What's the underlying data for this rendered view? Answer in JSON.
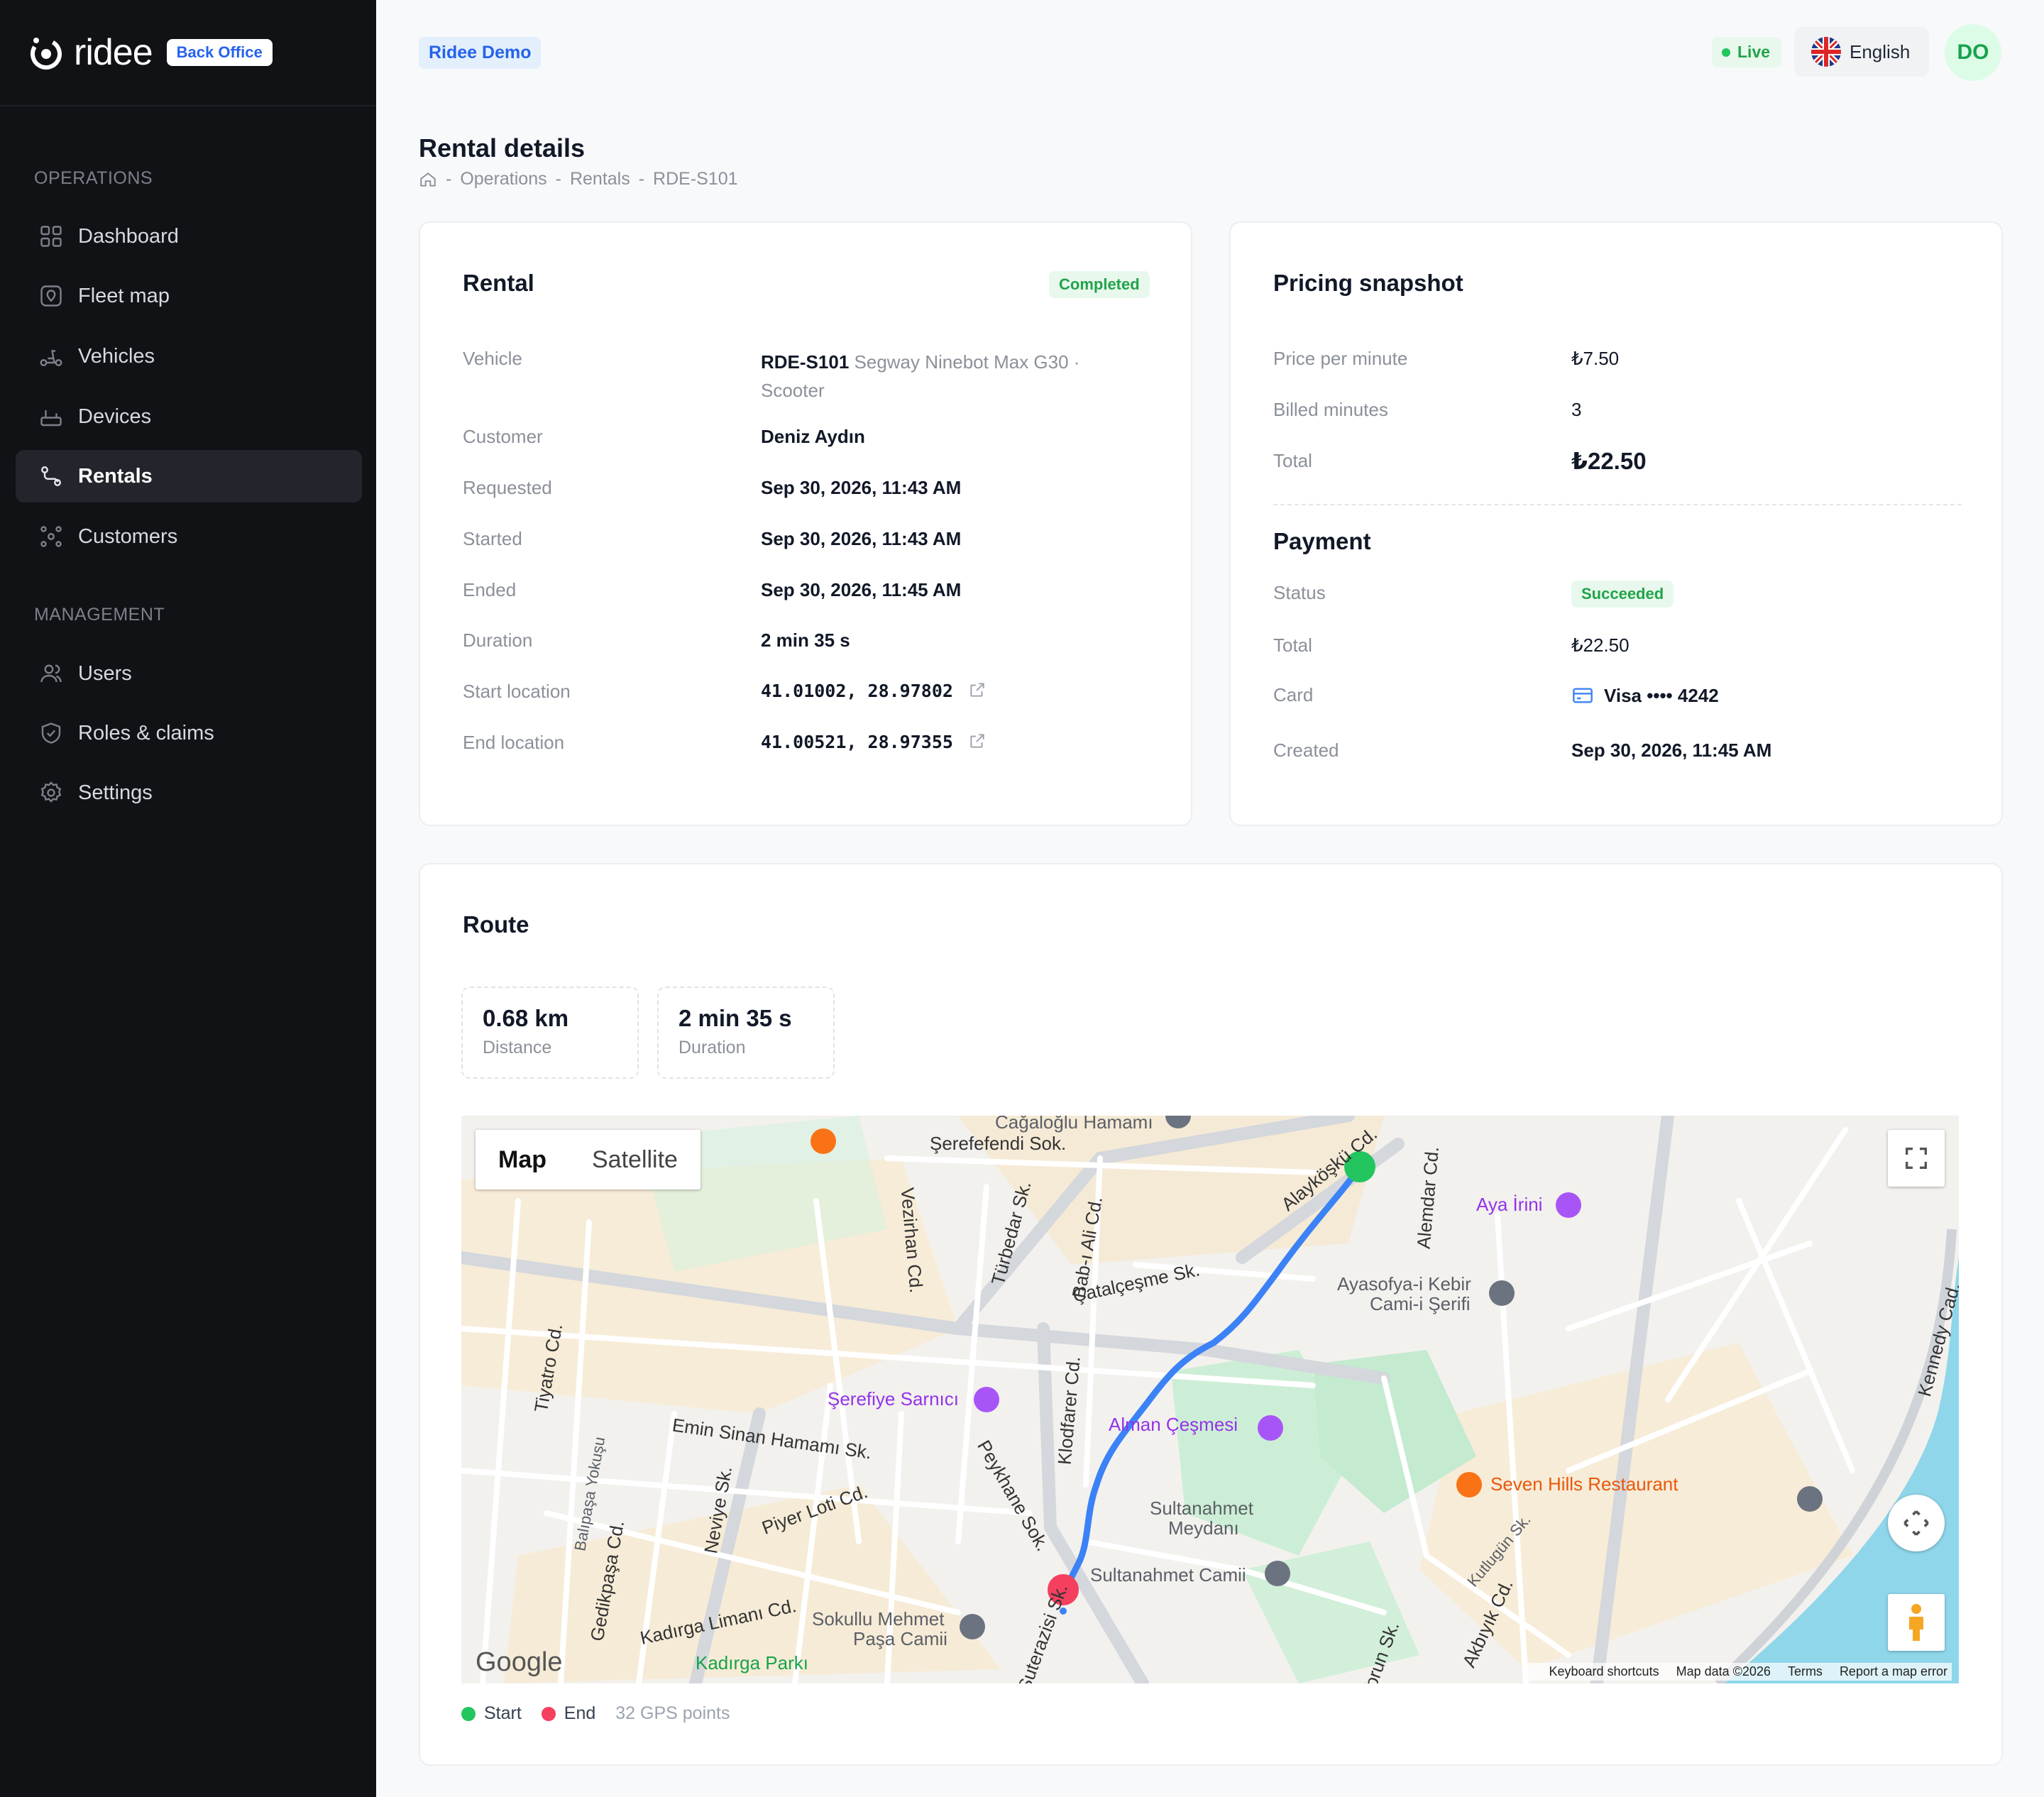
{
  "brand": {
    "name": "ridee",
    "badge": "Back Office"
  },
  "sidebar": {
    "sections": [
      {
        "title": "OPERATIONS"
      },
      {
        "title": "MANAGEMENT"
      }
    ],
    "items": [
      {
        "label": "Dashboard",
        "icon": "grid-icon"
      },
      {
        "label": "Fleet map",
        "icon": "map-pin-icon"
      },
      {
        "label": "Vehicles",
        "icon": "scooter-icon"
      },
      {
        "label": "Devices",
        "icon": "router-icon"
      },
      {
        "label": "Rentals",
        "icon": "route-icon",
        "active": true
      },
      {
        "label": "Customers",
        "icon": "customers-icon"
      },
      {
        "label": "Users",
        "icon": "users-icon"
      },
      {
        "label": "Roles & claims",
        "icon": "shield-check-icon"
      },
      {
        "label": "Settings",
        "icon": "gear-icon"
      }
    ]
  },
  "topbar": {
    "tenant": "Ridee Demo",
    "status": "Live",
    "language": "English",
    "avatar_initials": "DO"
  },
  "page": {
    "title": "Rental details",
    "breadcrumb": [
      "Operations",
      "Rentals",
      "RDE-S101"
    ]
  },
  "rental": {
    "title": "Rental",
    "status": "Completed",
    "fields": {
      "vehicle_label": "Vehicle",
      "vehicle_id": "RDE-S101",
      "vehicle_model": "Segway Ninebot Max G30 ·",
      "vehicle_type": "Scooter",
      "customer_label": "Customer",
      "customer": "Deniz Aydın",
      "requested_label": "Requested",
      "requested": "Sep 30, 2026, 11:43 AM",
      "started_label": "Started",
      "started": "Sep 30, 2026, 11:43 AM",
      "ended_label": "Ended",
      "ended": "Sep 30, 2026, 11:45 AM",
      "duration_label": "Duration",
      "duration": "2 min 35 s",
      "start_location_label": "Start location",
      "start_location": "41.01002, 28.97802",
      "end_location_label": "End location",
      "end_location": "41.00521, 28.97355"
    }
  },
  "pricing": {
    "title": "Pricing snapshot",
    "price_per_minute_label": "Price per minute",
    "price_per_minute": "₺7.50",
    "billed_minutes_label": "Billed minutes",
    "billed_minutes": "3",
    "total_label": "Total",
    "total": "₺22.50"
  },
  "payment": {
    "title": "Payment",
    "status_label": "Status",
    "status": "Succeeded",
    "total_label": "Total",
    "total": "₺22.50",
    "card_label": "Card",
    "card": "Visa •••• 4242",
    "created_label": "Created",
    "created": "Sep 30, 2026, 11:45 AM"
  },
  "route": {
    "title": "Route",
    "distance": "0.68 km",
    "distance_label": "Distance",
    "duration": "2 min 35 s",
    "duration_label": "Duration",
    "legend_start": "Start",
    "legend_end": "End",
    "gps_points": "32 GPS points",
    "colors": {
      "start": "#22c55e",
      "end": "#f43f5e",
      "path": "#3b82f6"
    }
  },
  "map": {
    "type_map": "Map",
    "type_satellite": "Satellite",
    "logo": "Google",
    "footer": [
      "Keyboard shortcuts",
      "Map data ©2026",
      "Terms",
      "Report a map error"
    ],
    "labels": {
      "l1": "Cağaloğlu Hamamı",
      "l2": "Şerefefendi Sok.",
      "l3": "Alayköşkü Cd.",
      "l4": "Aya İrini",
      "l5": "Alemdar Cd.",
      "l6": "Vezirhan Cd.",
      "l7": "Türbedar Sk.",
      "l8": "Bab-ı Ali Cd.",
      "l9": "Çatalçeşme Sk.",
      "l10": "Ayasofya-i Kebir",
      "l11": "Cami-i Şerifi",
      "l12": "Tiyatro Cd.",
      "l13": "Şerefiye Sarnıcı",
      "l14": "Klodfarer Cd.",
      "l15": "Alman Çeşmesi",
      "l16": "Emin Sinan Hamamı Sk.",
      "l17": "Seven Hills Restaurant",
      "l18": "Kennedy Cad.",
      "l19": "Balıpaşa Yokuşu",
      "l20": "Neviye Sk.",
      "l21": "Piyer Loti Cd.",
      "l22": "Peykhane Sok.",
      "l23": "Sultanahmet",
      "l24": "Meydanı",
      "l25": "Kutlugün Sk.",
      "l26": "Gedikpaşa Cd.",
      "l27": "Sultanahmet Camii",
      "l28": "Kadırga Limanı Cd.",
      "l29": "Sokullu Mehmet",
      "l30": "Paşa Camii",
      "l31": "Akbıyık Cd.",
      "l32": "Kadırga Parkı",
      "l33": "Suterazisi Sk.",
      "l34": "Torun Sk."
    }
  }
}
